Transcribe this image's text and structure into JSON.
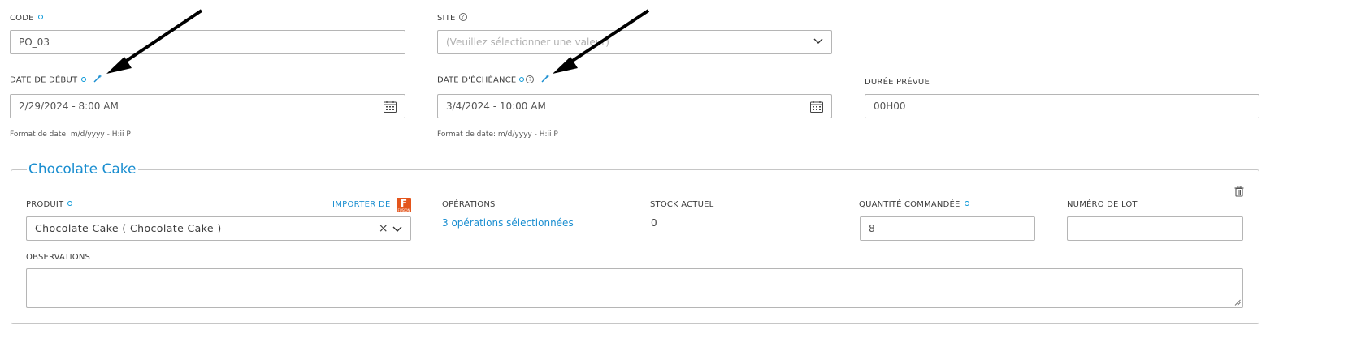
{
  "code": {
    "label": "CODE",
    "value": "PO_03"
  },
  "site": {
    "label": "SITE",
    "placeholder": "(Veuillez sélectionner une valeur)"
  },
  "start_date": {
    "label": "DATE DE DÉBUT",
    "value": "2/29/2024 - 8:00 AM",
    "format_hint": "Format de date: m/d/yyyy - H:ii P"
  },
  "due_date": {
    "label": "DATE D'ÉCHÉANCE",
    "value": "3/4/2024 - 10:00 AM",
    "format_hint": "Format de date: m/d/yyyy - H:ii P"
  },
  "duration": {
    "label": "DURÉE PRÉVUE",
    "value": "00H00"
  },
  "product_group": {
    "title": "Chocolate Cake",
    "product": {
      "label": "PRODUIT",
      "value": "Chocolate Cake ( Chocolate Cake )",
      "clear": "×"
    },
    "import": {
      "label": "IMPORTER DE",
      "logo_letter": "F",
      "logo_sub": "FUSION"
    },
    "operations": {
      "label": "OPÉRATIONS",
      "value": "3 opérations sélectionnées"
    },
    "stock": {
      "label": "STOCK ACTUEL",
      "value": "0"
    },
    "quantity": {
      "label": "QUANTITÉ COMMANDÉE",
      "value": "8"
    },
    "lot": {
      "label": "NUMÉRO DE LOT",
      "value": ""
    },
    "observations": {
      "label": "OBSERVATIONS",
      "value": ""
    }
  },
  "colors": {
    "accent": "#1a8ed0",
    "required_dot": "#0696d7",
    "fusion_logo": "#e4551c"
  },
  "icons": [
    "required-dot-icon",
    "help-icon",
    "magic-wand-icon",
    "calendar-icon",
    "chevron-down-icon",
    "clear-icon",
    "trash-icon",
    "fusion-logo-icon",
    "annotation-arrow-icon"
  ]
}
